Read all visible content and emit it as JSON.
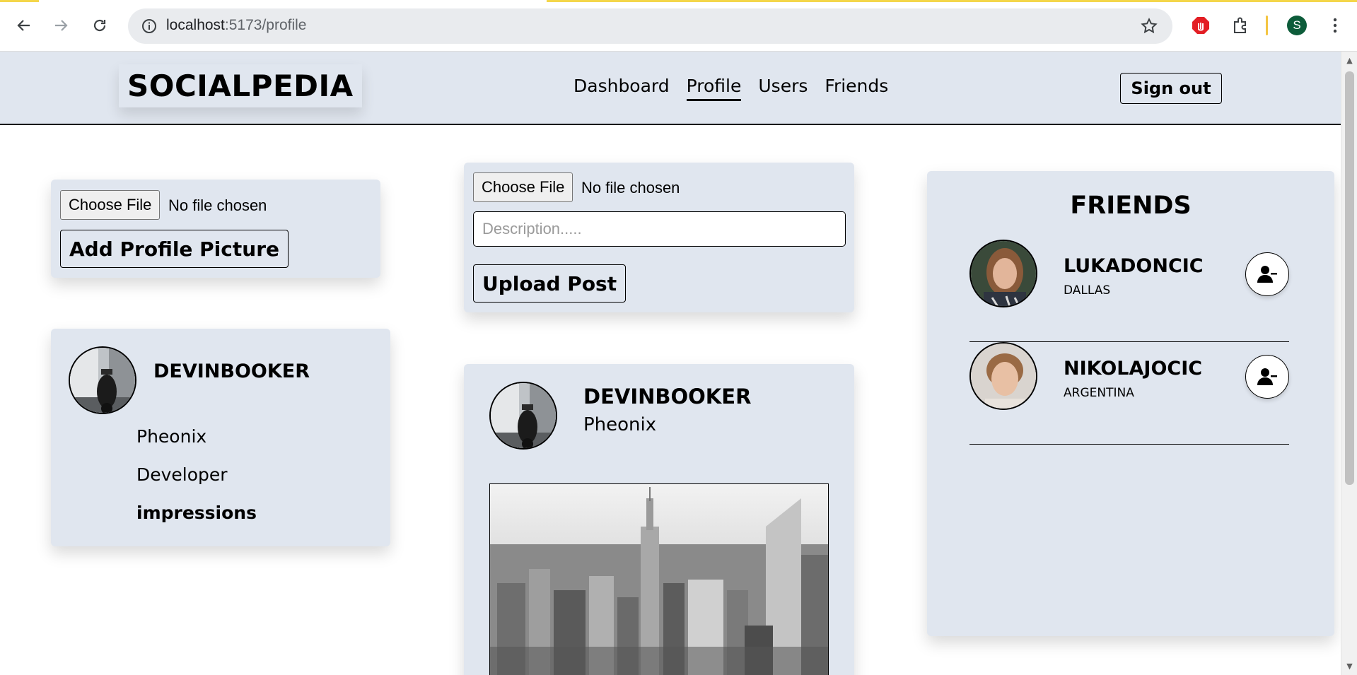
{
  "browser": {
    "url_host": "localhost",
    "url_path": ":5173/profile",
    "profile_initial": "S"
  },
  "app": {
    "logo": "SOCIALPEDIA",
    "nav": [
      "Dashboard",
      "Profile",
      "Users",
      "Friends"
    ],
    "active_nav": "Profile",
    "sign_out": "Sign out"
  },
  "profile_picture_card": {
    "choose_file": "Choose File",
    "file_status": "No file chosen",
    "add_button": "Add Profile Picture"
  },
  "user_card": {
    "username": "DEVINBOOKER",
    "location": "Pheonix",
    "occupation": "Developer",
    "impressions_label": "impressions"
  },
  "upload_card": {
    "choose_file": "Choose File",
    "file_status": "No file chosen",
    "description_placeholder": "Description.....",
    "upload_button": "Upload Post"
  },
  "post": {
    "username": "DEVINBOOKER",
    "location": "Pheonix"
  },
  "friends_panel": {
    "title": "FRIENDS",
    "friends": [
      {
        "name": "LUKADONCIC",
        "location": "DALLAS"
      },
      {
        "name": "NIKOLAJOCIC",
        "location": "ARGENTINA"
      }
    ]
  },
  "colors": {
    "card_bg": "#e0e6ef",
    "header_bg": "#e0e6ef",
    "accent_bar": "#f4d64a"
  }
}
